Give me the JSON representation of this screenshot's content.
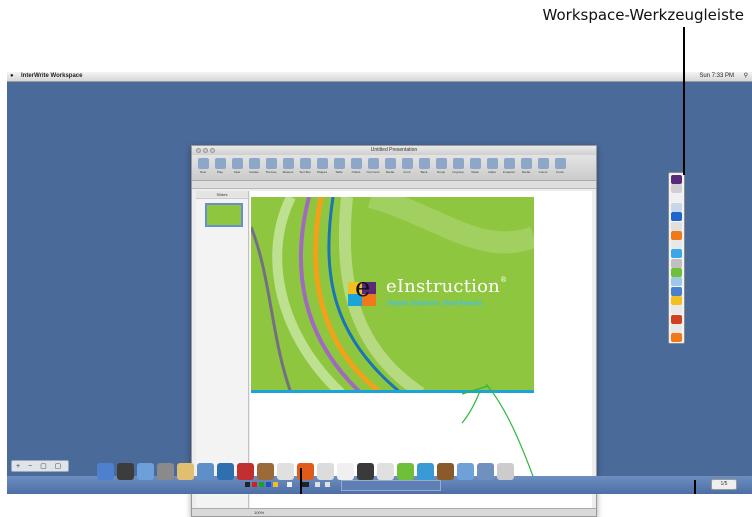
{
  "callout": {
    "label": "Workspace-Werkzeugleiste"
  },
  "menubar": {
    "app_name": "InterWrite Workspace",
    "status_text": "Sun 7:33 PM"
  },
  "window": {
    "title": "Untitled Presentation",
    "sidebar_header": "Slides",
    "zoom": "100%",
    "toolbar": [
      {
        "label": "New"
      },
      {
        "label": "Play"
      },
      {
        "label": "View"
      },
      {
        "label": "Guides"
      },
      {
        "label": "Themes"
      },
      {
        "label": "Masters"
      },
      {
        "label": "Text Box"
      },
      {
        "label": "Shapes"
      },
      {
        "label": "Table"
      },
      {
        "label": "Charts"
      },
      {
        "label": "Comment"
      },
      {
        "label": "Media"
      },
      {
        "label": "Front"
      },
      {
        "label": "Back"
      },
      {
        "label": "Group"
      },
      {
        "label": "Ungroup"
      },
      {
        "label": "Mask"
      },
      {
        "label": "Alpha"
      },
      {
        "label": "Inspector"
      },
      {
        "label": "Media"
      },
      {
        "label": "Colors"
      },
      {
        "label": "Fonts"
      }
    ]
  },
  "slide": {
    "brand": "eInstruction",
    "brand_reg": "®",
    "tagline": "Simple Solutions. Real Results."
  },
  "workspace_toolbar": {
    "tools": [
      "#5a2a7a",
      "#d0d0d0",
      "#f0f0f0",
      "#c9d6ea",
      "#1f66cc",
      "#e0e0e0",
      "#f07a1a",
      "#e8e8e8",
      "#3aa8e8",
      "#c0c0c0",
      "#6fbf3a",
      "#9ec8e8",
      "#4a7fd0",
      "#f2c020",
      "#e8e8e8",
      "#d04020",
      "#e8e8e8",
      "#f07a1a"
    ]
  },
  "dock": {
    "left_controls": "+ − ▢ ▢",
    "right_value": "1/5",
    "items": [
      "#4f7fcf",
      "#3c3c3c",
      "#6f9fd8",
      "#8a8a8a",
      "#e0c070",
      "#5f8fc8",
      "#2f6faf",
      "#c03030",
      "#9a6a3a",
      "#e0e0e0",
      "#e05a1a",
      "#dcdcdc",
      "#f0f0f0",
      "#3a3a3a",
      "#e0e0e0",
      "#6fbf3a",
      "#3a9ad8",
      "#8a5a2a",
      "#6fa0d8",
      "#7090c0",
      "#cccccc"
    ]
  },
  "colors": {
    "slide_green": "#8ec63f",
    "accent_blue": "#1aa4d8",
    "desktop": "#4a6a9a"
  }
}
